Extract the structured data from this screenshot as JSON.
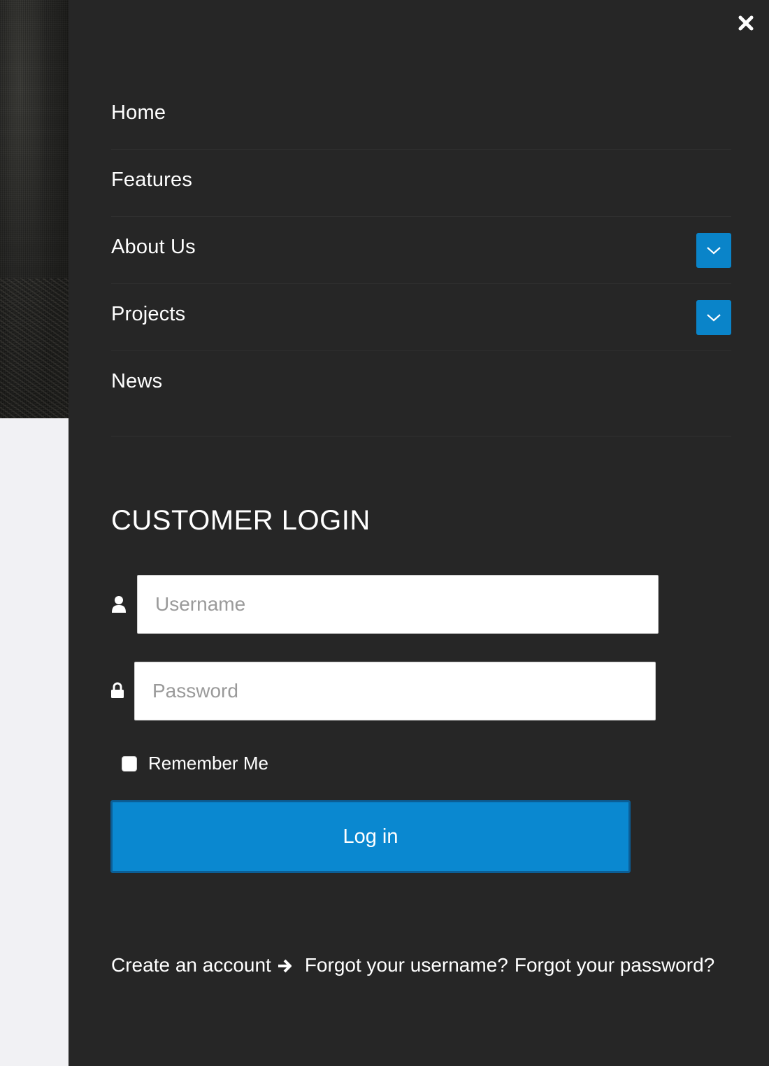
{
  "menu": {
    "items": [
      {
        "label": "Home",
        "has_submenu": false
      },
      {
        "label": "Features",
        "has_submenu": false
      },
      {
        "label": "About Us",
        "has_submenu": true
      },
      {
        "label": "Projects",
        "has_submenu": true
      },
      {
        "label": "News",
        "has_submenu": false
      }
    ]
  },
  "login": {
    "title": "CUSTOMER LOGIN",
    "username": {
      "placeholder": "Username",
      "value": ""
    },
    "password": {
      "placeholder": "Password",
      "value": ""
    },
    "remember_label": "Remember Me",
    "remember_checked": false,
    "submit_label": "Log in",
    "create_account_label": "Create an account",
    "forgot_username_label": "Forgot your username?",
    "forgot_password_label": "Forgot your password?"
  },
  "icons": {
    "close": "close-icon",
    "submenu_toggle": "chevron-down-icon",
    "username": "user-icon",
    "password": "lock-icon",
    "create_account": "arrow-right-icon"
  },
  "colors": {
    "panel_bg": "#262626",
    "accent": "#0a88d0",
    "accent_border": "#0b5e96",
    "text": "#ffffff"
  }
}
